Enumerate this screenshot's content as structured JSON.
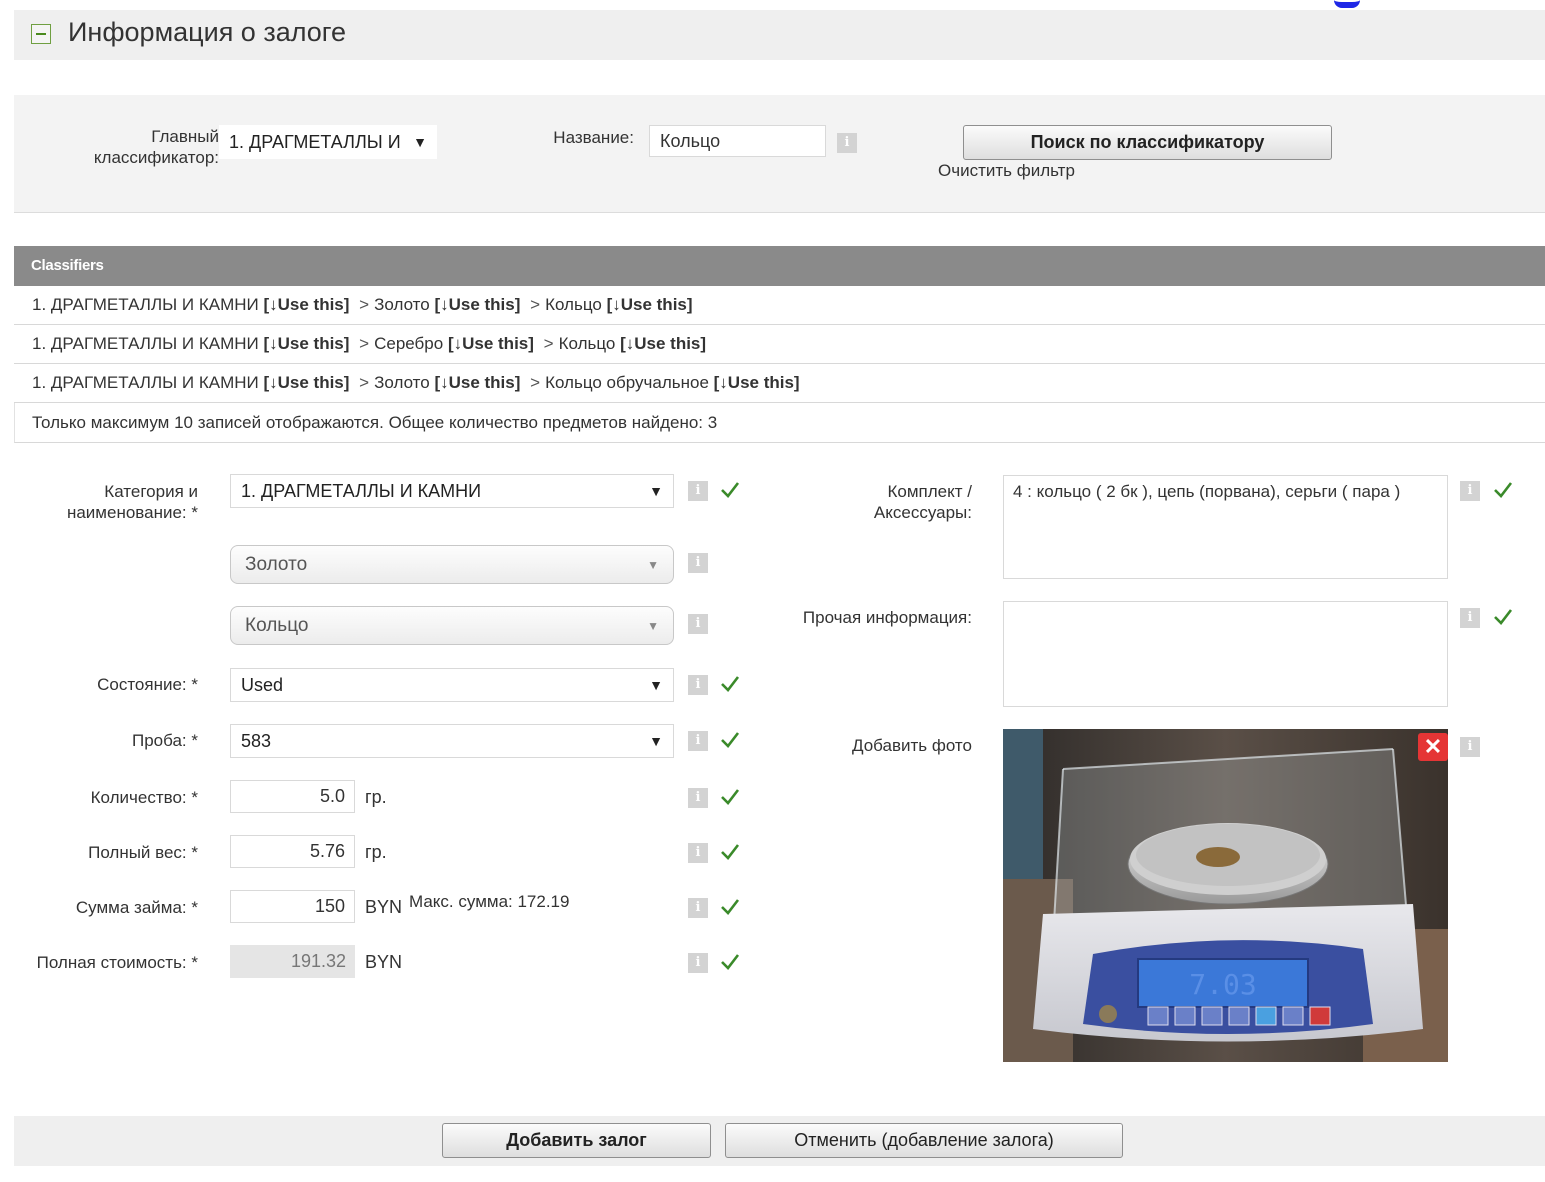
{
  "header": {
    "title": "Информация о залоге"
  },
  "filter": {
    "main_classifier_label": "Главный классификатор:",
    "main_classifier_value": "1. ДРАГМЕТАЛЛЫ И",
    "name_label": "Название:",
    "name_value": "Кольцо",
    "search_button": "Поиск по классификатору",
    "clear_filter": "Очистить фильтр"
  },
  "classifiers": {
    "header": "Classifiers",
    "rows": [
      {
        "c1": "1. ДРАГМЕТАЛЛЫ И КАМНИ",
        "c2": "Золото",
        "c3": "Кольцо"
      },
      {
        "c1": "1. ДРАГМЕТАЛЛЫ И КАМНИ",
        "c2": "Серебро",
        "c3": "Кольцо"
      },
      {
        "c1": "1. ДРАГМЕТАЛЛЫ И КАМНИ",
        "c2": "Золото",
        "c3": "Кольцо обручальное"
      }
    ],
    "use_this": "[↓Use this]",
    "separator": ">",
    "note": "Только максимум 10 записей отображаются. Общее количество предметов найдено: 3"
  },
  "form": {
    "category_label": "Категория и наименование: *",
    "category_value": "1. ДРАГМЕТАЛЛЫ И КАМНИ",
    "subcategory_value": "Золото",
    "item_value": "Кольцо",
    "condition_label": "Состояние: *",
    "condition_value": "Used",
    "purity_label": "Проба: *",
    "purity_value": "583",
    "quantity_label": "Количество: *",
    "quantity_value": "5.0",
    "quantity_unit": "гр.",
    "weight_label": "Полный вес: *",
    "weight_value": "5.76",
    "weight_unit": "гр.",
    "loan_label": "Сумма займа: *",
    "loan_value": "150",
    "loan_unit": "BYN",
    "max_sum": "Макс. сумма: 172.19",
    "total_label": "Полная стоимость: *",
    "total_value": "191.32",
    "total_unit": "BYN",
    "kit_label": "Комплект / Аксессуары:",
    "kit_value": "4 : кольцо ( 2 бк ), цепь (порвана), серьги ( пара )",
    "other_label": "Прочая информация:",
    "other_value": "",
    "photo_label": "Добавить фото",
    "scale_display": "7.03"
  },
  "actions": {
    "add_button": "Добавить залог",
    "cancel_button": "Отменить (добавление залога)"
  },
  "icons": {
    "info": "i",
    "delete": "✕"
  },
  "colors": {
    "check": "#3a8a2a",
    "classifiers_header": "#8a8a8a",
    "delete_button": "#e53535",
    "accent_mark": "#1e27e6"
  }
}
